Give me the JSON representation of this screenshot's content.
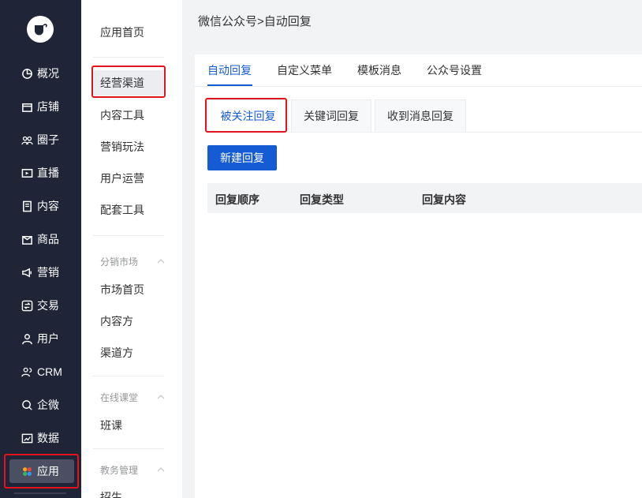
{
  "nav": {
    "logo_icon": "cup-logo-icon",
    "items": [
      {
        "label": "概况",
        "icon": "chart-pie-icon"
      },
      {
        "label": "店铺",
        "icon": "shop-icon"
      },
      {
        "label": "圈子",
        "icon": "group-icon"
      },
      {
        "label": "直播",
        "icon": "live-icon"
      },
      {
        "label": "内容",
        "icon": "document-icon"
      },
      {
        "label": "商品",
        "icon": "box-icon"
      },
      {
        "label": "营销",
        "icon": "megaphone-icon"
      },
      {
        "label": "交易",
        "icon": "exchange-icon"
      },
      {
        "label": "用户",
        "icon": "user-icon"
      },
      {
        "label": "CRM",
        "icon": "crm-icon"
      },
      {
        "label": "企微",
        "icon": "wecom-icon"
      },
      {
        "label": "数据",
        "icon": "data-icon"
      },
      {
        "label": "应用",
        "icon": "apps-icon"
      }
    ],
    "active_color": "#4a5061"
  },
  "sub": {
    "home": "应用首页",
    "items": [
      "经营渠道",
      "内容工具",
      "营销玩法",
      "用户运营",
      "配套工具"
    ],
    "group_market": "分销市场",
    "market_items": [
      "市场首页",
      "内容方",
      "渠道方"
    ],
    "group_class": "在线课堂",
    "class_items": [
      "班课"
    ],
    "group_edu": "教务管理",
    "edu_items": [
      "招生"
    ]
  },
  "breadcrumb": "微信公众号>自动回复",
  "tabs": [
    "自动回复",
    "自定义菜单",
    "模板消息",
    "公众号设置"
  ],
  "subtabs": [
    "被关注回复",
    "关键词回复",
    "收到消息回复"
  ],
  "new_button": "新建回复",
  "table": {
    "headers": [
      "回复顺序",
      "回复类型",
      "回复内容"
    ]
  },
  "colors": {
    "accent": "#155bd4",
    "nav_bg": "#1f2537",
    "highlight": "#e0141e"
  }
}
